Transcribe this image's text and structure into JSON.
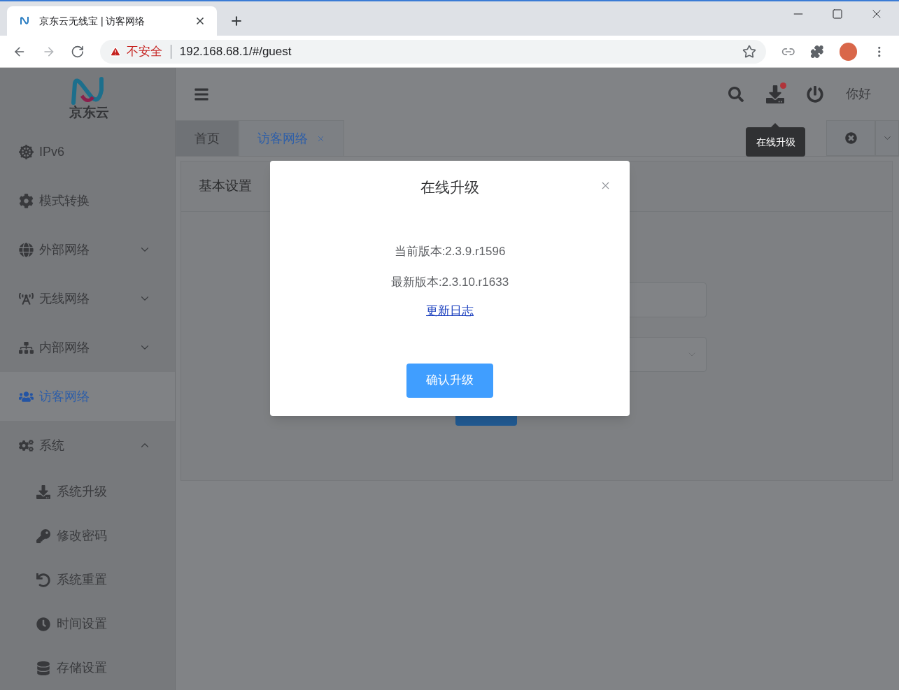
{
  "browser": {
    "tab_title": "京东云无线宝 | 访客网络",
    "security_label": "不安全",
    "url": "192.168.68.1/#/guest"
  },
  "header": {
    "logo_text": "京东云",
    "update_badge": true,
    "user": "你好",
    "tooltip": "在线升级"
  },
  "sidebar": {
    "items": [
      {
        "label": "IPv6",
        "selected": false
      },
      {
        "label": "模式转换",
        "selected": false
      },
      {
        "label": "外部网络",
        "selected": false,
        "expanded": false
      },
      {
        "label": "无线网络",
        "selected": false,
        "expanded": false
      },
      {
        "label": "内部网络",
        "selected": false,
        "expanded": false
      },
      {
        "label": "访客网络",
        "selected": true
      },
      {
        "label": "系统",
        "selected": false,
        "expanded": true,
        "children": [
          {
            "label": "系统升级",
            "selected": false
          },
          {
            "label": "修改密码",
            "selected": false
          },
          {
            "label": "系统重置",
            "selected": false
          },
          {
            "label": "时间设置",
            "selected": false
          },
          {
            "label": "存储设置",
            "selected": false
          }
        ]
      }
    ]
  },
  "tabs": [
    {
      "label": "首页",
      "selected": false,
      "closable": false
    },
    {
      "label": "访客网络",
      "selected": true,
      "closable": true
    }
  ],
  "card": {
    "title": "基本设置"
  },
  "dialog": {
    "title": "在线升级",
    "current_version": "当前版本:2.3.9.r1596",
    "latest_version": "最新版本:2.3.10.r1633",
    "changelog_link": "更新日志",
    "confirm_button": "确认升级"
  }
}
